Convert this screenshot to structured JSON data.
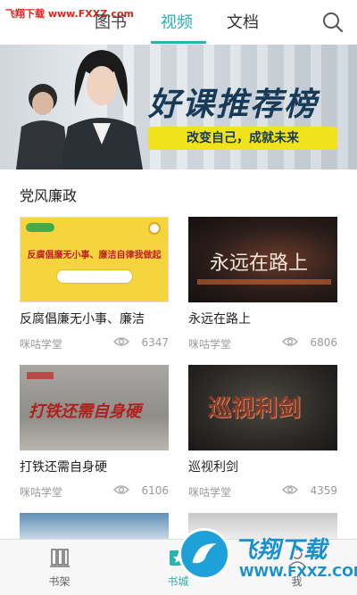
{
  "watermark": {
    "top_text": "飞翔下载 www.FXXZ.com",
    "brand": "飞翔下载",
    "url": "WWW.FXXZ.COM"
  },
  "tabs": [
    {
      "label": "图书"
    },
    {
      "label": "视频"
    },
    {
      "label": "文档"
    }
  ],
  "active_tab": "视频",
  "accent_color": "#2bb3b0",
  "banner": {
    "title": "好课推荐榜",
    "subtitle": "改变自己，成就未来"
  },
  "section": {
    "title": "党风廉政"
  },
  "videos": [
    {
      "title": "反腐倡廉无小事、廉洁",
      "source": "咪咕学堂",
      "views": "6347",
      "thumb_text": "反腐倡廉无小事、廉洁自律我做起"
    },
    {
      "title": "永远在路上",
      "source": "咪咕学堂",
      "views": "6806",
      "thumb_text": "永远在路上"
    },
    {
      "title": "打铁还需自身硬",
      "source": "咪咕学堂",
      "views": "6106",
      "thumb_text": "打铁还需自身硬"
    },
    {
      "title": "巡视利剑",
      "source": "咪咕学堂",
      "views": "4359",
      "thumb_text": "巡视利剑"
    }
  ],
  "bottom_nav": [
    {
      "label": "书架",
      "icon": "bookshelf-icon"
    },
    {
      "label": "书城",
      "icon": "store-icon"
    },
    {
      "label": "我",
      "icon": "person-icon"
    }
  ]
}
